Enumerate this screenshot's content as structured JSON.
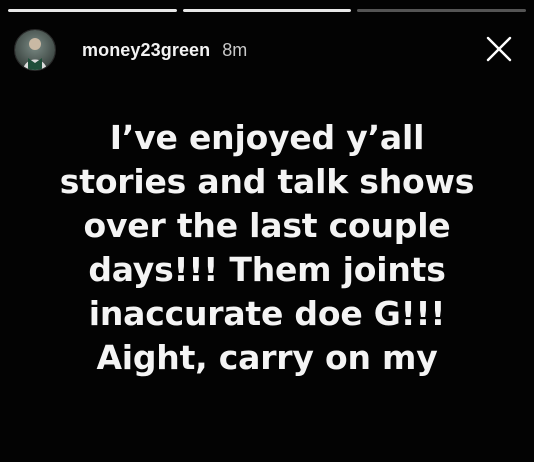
{
  "story": {
    "progress": [
      {
        "fill": 100
      },
      {
        "fill": 100
      },
      {
        "fill": 0
      }
    ],
    "header": {
      "username": "money23green",
      "timestamp": "8m"
    },
    "caption": {
      "lines": [
        "I’ve enjoyed y’all",
        "stories and talk shows",
        "over the last couple",
        "days!!! Them joints",
        "inaccurate doe G!!!",
        "Aight, carry on my"
      ]
    },
    "icons": {
      "close": "close-icon",
      "avatar": "avatar"
    },
    "colors": {
      "background": "#000000",
      "text": "#f4f4f4"
    }
  }
}
